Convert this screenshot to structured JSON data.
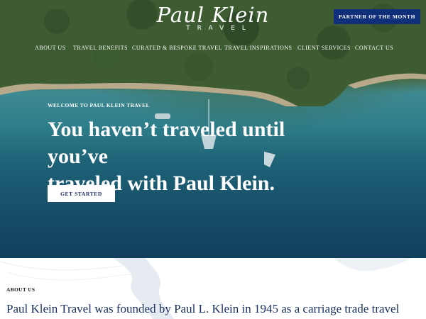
{
  "logo": {
    "script": "Paul Klein",
    "sub": "TRAVEL"
  },
  "partner_button": "PARTNER OF THE MONTH",
  "nav": {
    "items": [
      "ABOUT US",
      "TRAVEL BENEFITS",
      "CURATED & BESPOKE TRAVEL",
      "TRAVEL INSPIRATIONS",
      "CLIENT SERVICES",
      "CONTACT US"
    ]
  },
  "hero": {
    "welcome": "WELCOME TO PAUL KLEIN TRAVEL",
    "headline_line1": "You haven’t traveled until you’ve",
    "headline_line2": "traveled with Paul Klein.",
    "cta": "GET STARTED"
  },
  "about": {
    "label": "ABOUT US",
    "text": "Paul Klein Travel was founded by Paul L. Klein in 1945 as a carriage trade travel"
  },
  "colors": {
    "partner_button_bg": "#0f2f7a",
    "heading_blue": "#17305f"
  }
}
